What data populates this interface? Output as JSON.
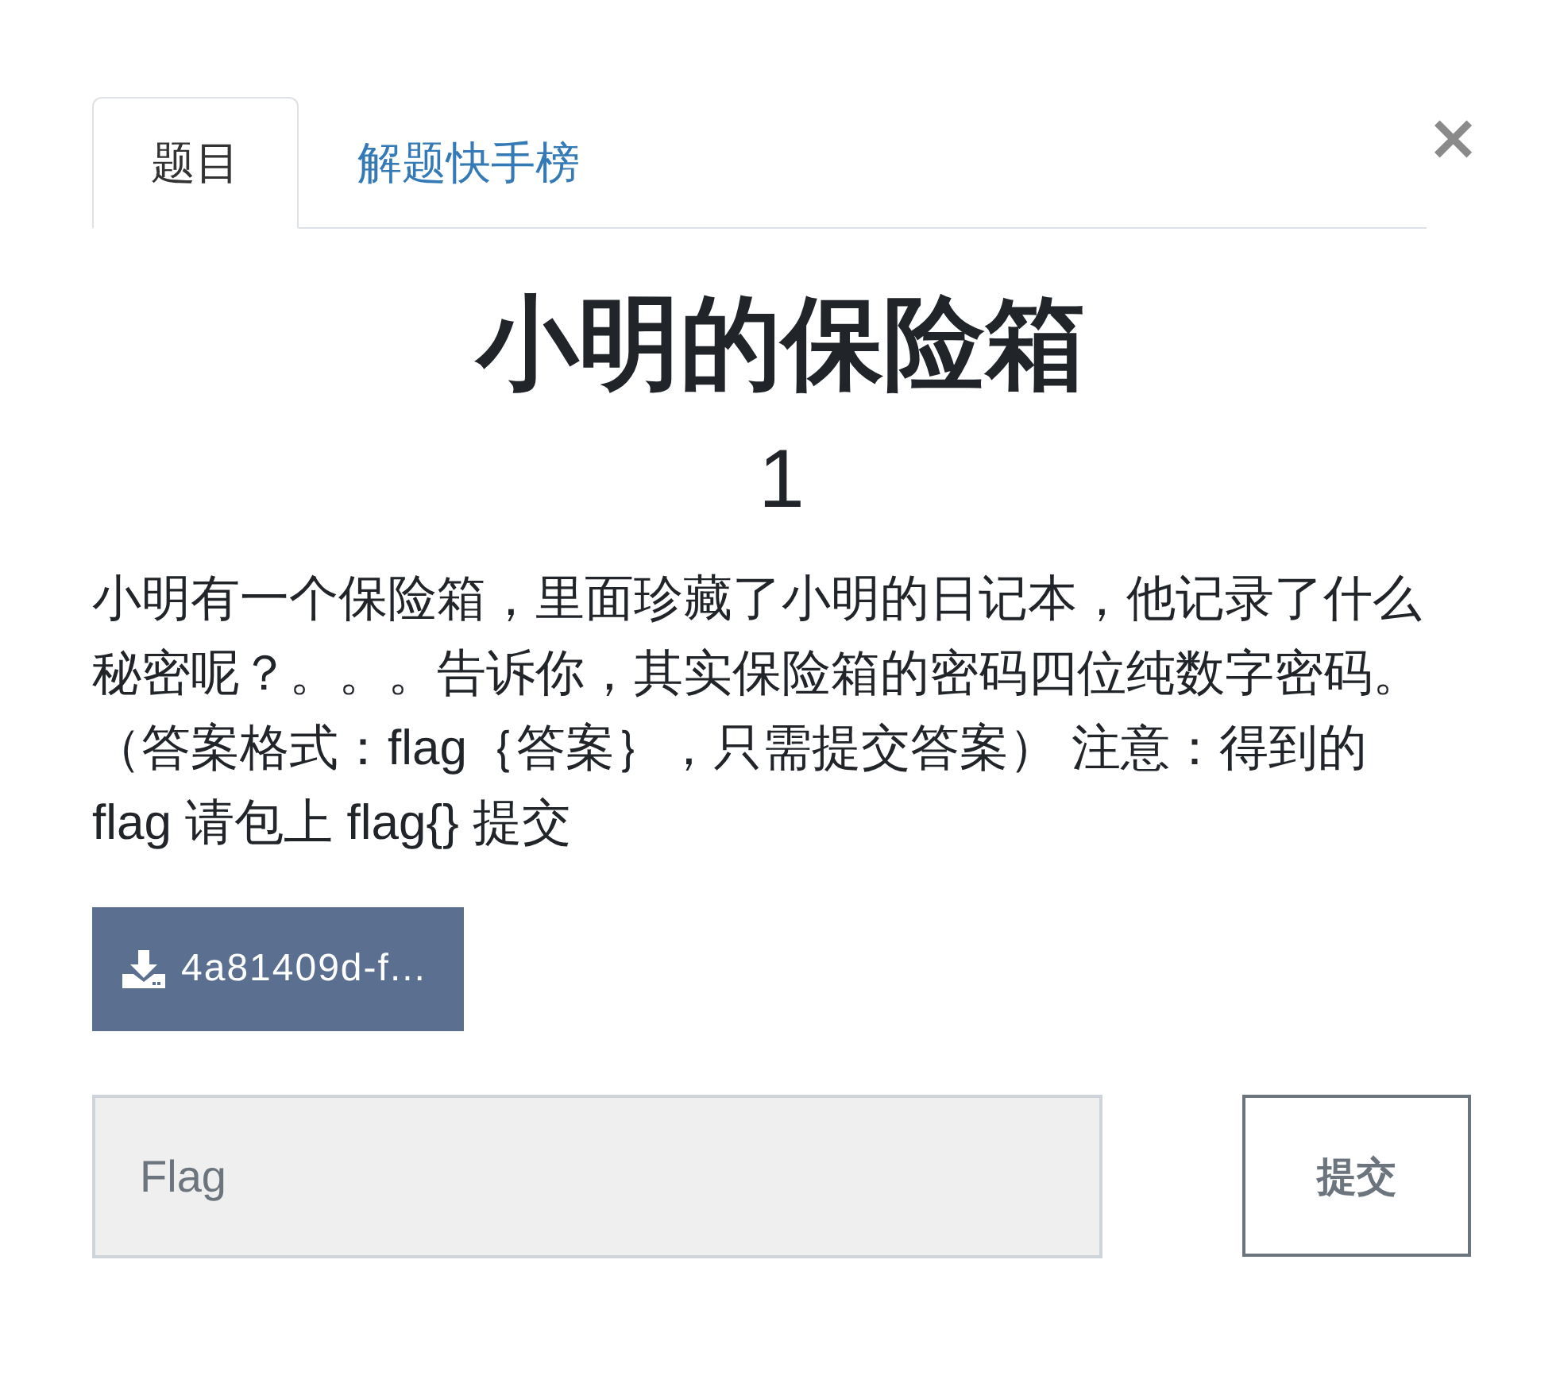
{
  "tabs": [
    {
      "label": "题目",
      "selected": true
    },
    {
      "label": "解题快手榜",
      "selected": false
    }
  ],
  "close_button": "×",
  "challenge": {
    "title": "小明的保险箱",
    "value": "1",
    "description_lines": [
      "小明有一个保险箱，里面珍藏了小明的日记本，他记录了什么",
      "秘密呢？。。。告诉你，其实保险箱的密码四位纯数字密码。",
      "（答案格式：flag｛答案｝，只需提交答案） 注意：得到的",
      "flag 请包上 flag{} 提交"
    ]
  },
  "attachment": {
    "label": "4a81409d-f..."
  },
  "flag_form": {
    "placeholder": "Flag",
    "submit": "提交"
  }
}
